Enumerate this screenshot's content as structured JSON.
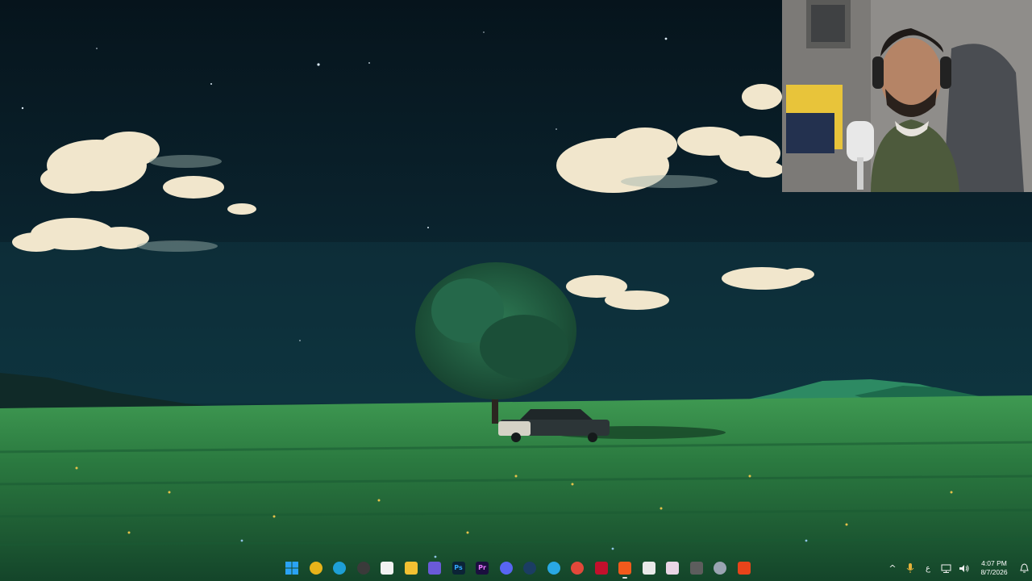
{
  "desktop": {
    "wallpaper": "night-meadow-tree-car",
    "colors": {
      "sky_top": "#06141c",
      "sky_bottom": "#0d3340",
      "meadow_near": "#1f6a3a",
      "meadow_far": "#3f9a52",
      "tree": "#1f5a3f",
      "cloud": "#f1e6cc"
    }
  },
  "webcam": {
    "label": "webcam-overlay"
  },
  "taskbar": {
    "apps": [
      {
        "name": "start-icon",
        "glyph": "",
        "color": "#2aa3f5"
      },
      {
        "name": "chrome-icon",
        "glyph": "",
        "color": "#e8b31a"
      },
      {
        "name": "edge-icon",
        "glyph": "",
        "color": "#1e9fd6"
      },
      {
        "name": "obs-icon",
        "glyph": "",
        "color": "#3a3a3a"
      },
      {
        "name": "microsoft-store-icon",
        "glyph": "",
        "color": "#f2f2f2"
      },
      {
        "name": "file-explorer-icon",
        "glyph": "",
        "color": "#f2c132"
      },
      {
        "name": "gem-app-icon",
        "glyph": "",
        "color": "#6a5ad8"
      },
      {
        "name": "photoshop-icon",
        "glyph": "Ps",
        "color": "#0b2336"
      },
      {
        "name": "premiere-pro-icon",
        "glyph": "Pr",
        "color": "#1b0f3f"
      },
      {
        "name": "discord-icon",
        "glyph": "",
        "color": "#5865f2"
      },
      {
        "name": "steam-icon",
        "glyph": "",
        "color": "#1b3d63"
      },
      {
        "name": "telegram-icon",
        "glyph": "",
        "color": "#29a8e4"
      },
      {
        "name": "red-app-icon",
        "glyph": "",
        "color": "#e2483a"
      },
      {
        "name": "affinity-icon",
        "glyph": "",
        "color": "#c2102c"
      },
      {
        "name": "brave-icon",
        "glyph": "",
        "color": "#f25a1c"
      },
      {
        "name": "document-app-icon",
        "glyph": "",
        "color": "#e9e9e9"
      },
      {
        "name": "paint-icon",
        "glyph": "",
        "color": "#ead6e6"
      },
      {
        "name": "close-window-app-icon",
        "glyph": "",
        "color": "#5d5d5d"
      },
      {
        "name": "settings-icon",
        "glyph": "",
        "color": "#9aa4b2"
      },
      {
        "name": "brave-beta-icon",
        "glyph": "",
        "color": "#e8441a"
      }
    ],
    "active_app_index": 14,
    "tray": {
      "chevron": "^",
      "mic": "🎙",
      "lang": "ع",
      "clock_time": "4:07 PM",
      "clock_date": "8/7/2026"
    }
  }
}
